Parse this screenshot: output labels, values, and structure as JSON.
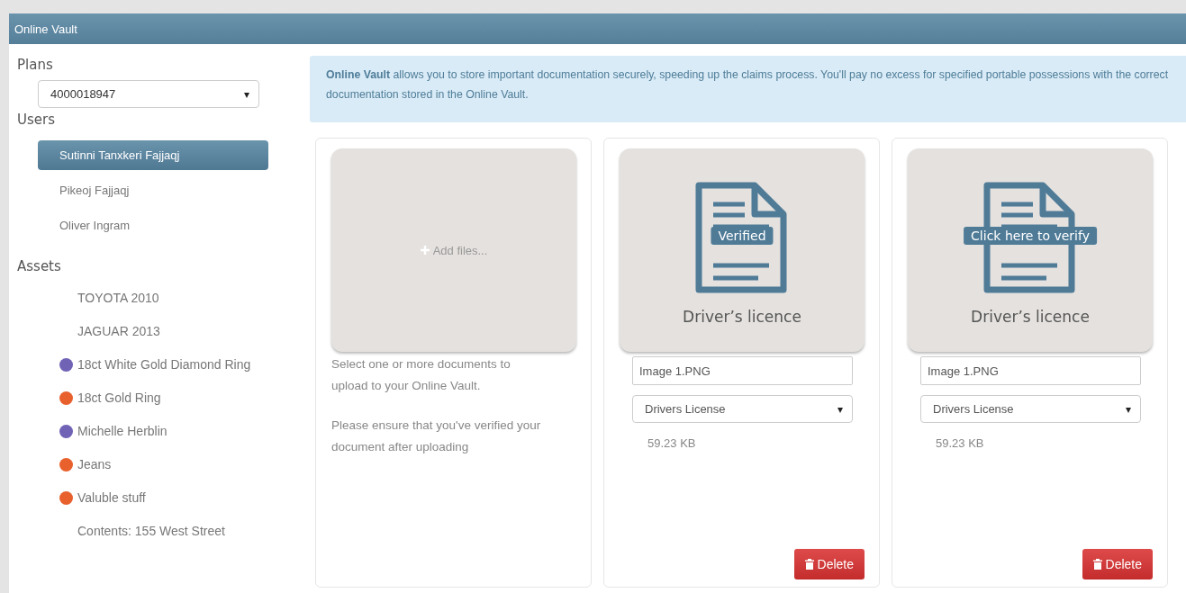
{
  "window": {
    "title": "Online Vault"
  },
  "sidebar": {
    "plans_heading": "Plans",
    "plan_select": {
      "value": "4000018947",
      "arrow": "▾"
    },
    "users_heading": "Users",
    "users": [
      {
        "name": "Sutinni Tanxkeri Fajjaqj",
        "selected": true
      },
      {
        "name": "Pikeoj Fajjaqj",
        "selected": false
      },
      {
        "name": "Oliver Ingram",
        "selected": false
      }
    ],
    "assets_heading": "Assets",
    "assets": [
      {
        "name": "TOYOTA 2010"
      },
      {
        "name": "JAGUAR 2013"
      },
      {
        "name": "18ct White Gold Diamond Ring",
        "color": "#7062b5"
      },
      {
        "name": "18ct Gold Ring",
        "color": "#e8602c"
      },
      {
        "name": "Michelle Herblin",
        "color": "#7062b5"
      },
      {
        "name": "Jeans",
        "color": "#e8602c"
      },
      {
        "name": "Valuble stuff",
        "color": "#e8602c"
      },
      {
        "name": "Contents: 155 West Street"
      }
    ]
  },
  "info": "**Online Vault** allows you to store important documentation securely, speeding up the claims process. You'll pay no excess for specified portable possessions with the correct documentation stored in the Online Vault.",
  "upload": {
    "button": "Add files...",
    "notes": [
      "Select one or more documents to upload to your Online Vault.",
      "Please ensure that you've verified your document after uploading"
    ]
  },
  "documents": [
    {
      "badge": "Verified",
      "title": "Driver’s licence",
      "filename": "Image 1.PNG",
      "type": "Drivers License",
      "size": "59.23 KB",
      "delete": "Delete"
    },
    {
      "badge": "Click here to verify",
      "title": "Driver’s licence",
      "filename": "Image 1.PNG",
      "type": "Drivers License",
      "size": "59.23 KB",
      "delete": "Delete"
    }
  ]
}
